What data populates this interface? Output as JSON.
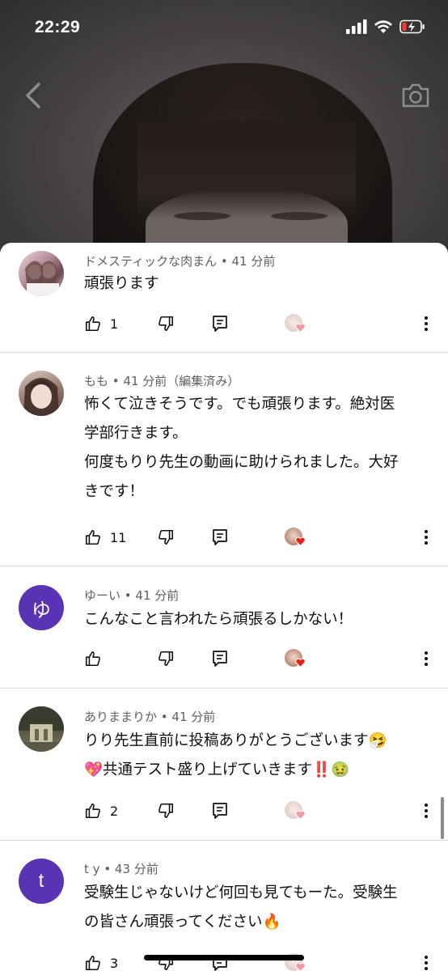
{
  "status": {
    "time": "22:29"
  },
  "comments": [
    {
      "author": "ドメスティックな肉まん",
      "time": "• 41 分前",
      "lines": [
        "頑張ります"
      ],
      "likes": "1",
      "avatar": {
        "type": "photo",
        "color": "#c9a9b3"
      },
      "creator_heart_style": "faded"
    },
    {
      "author": "もも",
      "time": "• 41 分前（編集済み）",
      "lines": [
        "怖くて泣きそうです。でも頑張ります。絶対医",
        "学部行きます。",
        "何度もりり先生の動画に助けられました。大好",
        "きです！"
      ],
      "likes": "11",
      "avatar": {
        "type": "photo",
        "color": "#b59a8c"
      },
      "creator_heart_style": "red"
    },
    {
      "author": "ゆーい",
      "time": "• 41 分前",
      "lines": [
        "こんなこと言われたら頑張るしかない！"
      ],
      "likes": "",
      "avatar": {
        "type": "letter",
        "letter": "ゆ",
        "color": "#5a33b5"
      },
      "creator_heart_style": "red"
    },
    {
      "author": "ありままりか",
      "time": "• 41 分前",
      "lines": [
        "りり先生直前に投稿ありがとうございます🤧",
        "💖共通テスト盛り上げていきます‼️🤢"
      ],
      "likes": "2",
      "avatar": {
        "type": "photo",
        "color": "#4a4a3a"
      },
      "creator_heart_style": "faded"
    },
    {
      "author": "t y",
      "time": "• 43 分前",
      "lines": [
        "受験生じゃないけど何回も見てもーた。受験生",
        "の皆さん頑張ってください🔥"
      ],
      "likes": "3",
      "avatar": {
        "type": "letter",
        "letter": "t",
        "color": "#5a33b5"
      },
      "creator_heart_style": "faded"
    }
  ]
}
